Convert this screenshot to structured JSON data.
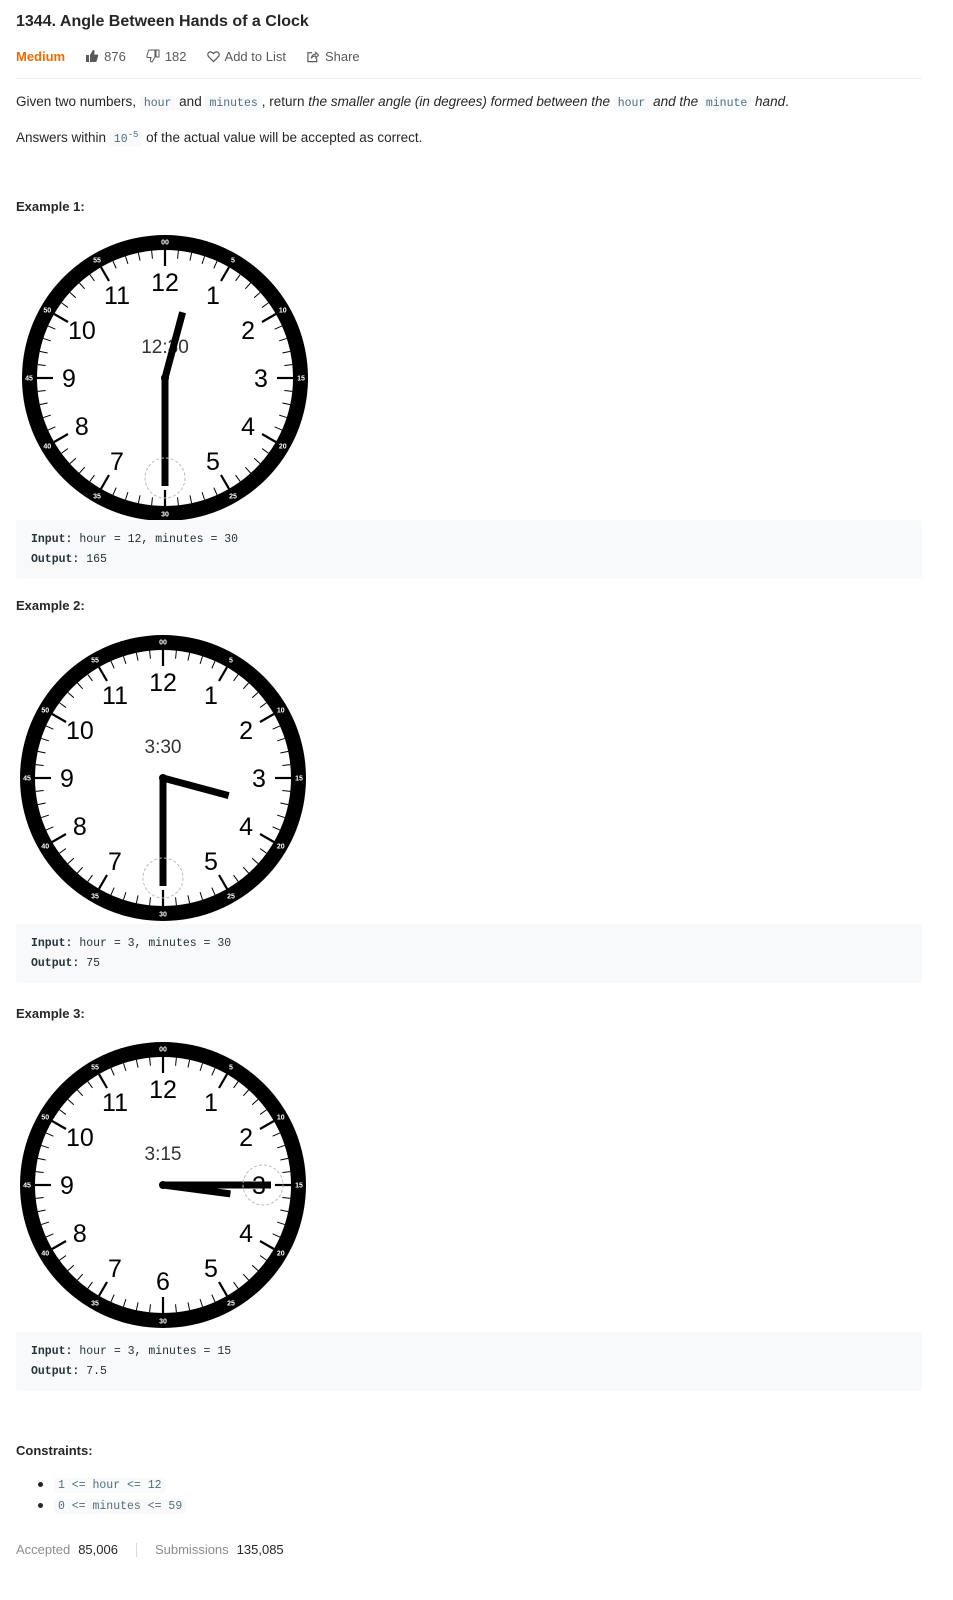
{
  "problem": {
    "title": "1344. Angle Between Hands of a Clock",
    "difficulty": "Medium",
    "likes": "876",
    "dislikes": "182",
    "add_to_list": "Add to List",
    "share": "Share",
    "difficulty_color": "#ef6c00"
  },
  "description": {
    "p1_a": "Given two numbers, ",
    "p1_code1": "hour",
    "p1_b": " and ",
    "p1_code2": "minutes",
    "p1_c": ", return ",
    "p1_em1": "the smaller angle (in degrees) formed between the ",
    "p1_code3": "hour",
    "p1_em2": " and the ",
    "p1_code4": "minute",
    "p1_em3": " hand",
    "p1_end": ".",
    "p2_a": "Answers within ",
    "p2_code_base": "10",
    "p2_code_exp": "-5",
    "p2_b": " of the actual value will be accepted as correct."
  },
  "examples": [
    {
      "heading": "Example 1:",
      "clock_time": "12:30",
      "input_label": "Input:",
      "input": " hour = 12, minutes = 30",
      "output_label": "Output:",
      "output": " 165"
    },
    {
      "heading": "Example 2:",
      "clock_time": "3:30",
      "input_label": "Input:",
      "input": " hour = 3, minutes = 30",
      "output_label": "Output:",
      "output": " 75"
    },
    {
      "heading": "Example 3:",
      "clock_time": "3:15",
      "input_label": "Input:",
      "input": " hour = 3, minutes = 15",
      "output_label": "Output:",
      "output": " 7.5"
    }
  ],
  "clock_face": {
    "hour_numerals": [
      "12",
      "1",
      "2",
      "3",
      "4",
      "5",
      "6",
      "7",
      "8",
      "9",
      "10",
      "11"
    ],
    "minute_labels": [
      "00",
      "5",
      "10",
      "15",
      "20",
      "25",
      "30",
      "35",
      "40",
      "45",
      "50",
      "55"
    ]
  },
  "constraints": {
    "heading": "Constraints:",
    "items": [
      "1 <= hour <= 12",
      "0 <= minutes <= 59"
    ]
  },
  "stats": {
    "accepted_label": "Accepted",
    "accepted": "85,006",
    "submissions_label": "Submissions",
    "submissions": "135,085"
  }
}
